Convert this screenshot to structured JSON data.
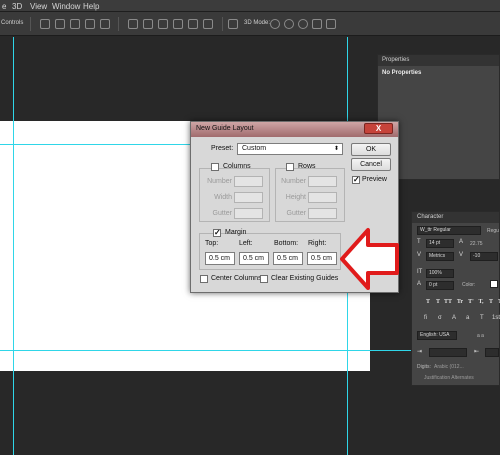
{
  "menu": [
    "e",
    "3D",
    "View",
    "Window",
    "Help"
  ],
  "options_bar": {
    "controls_label": "Controls",
    "mode_label": "3D Mode:"
  },
  "properties": {
    "title": "Properties",
    "content": "No Properties"
  },
  "character": {
    "title": "Character",
    "font_family": "W_ttr Regular",
    "font_style": "Regu",
    "size": "14 pt",
    "leading": "22.75",
    "kerning": "Metrics",
    "tracking": "-10",
    "vertical_scale": "100%",
    "baseline": "0 pt",
    "color_label": "Color:",
    "type_buttons": [
      "T",
      "T",
      "TT",
      "Tr",
      "T'",
      "T,",
      "T",
      "T"
    ],
    "language": "English: USA",
    "antialias": "a a",
    "digits_label": "Digits:",
    "digits_value": "Arabic (012...",
    "justification": "Justification Alternates"
  },
  "dialog": {
    "title": "New Guide Layout",
    "close_label": "X",
    "preset_label": "Preset:",
    "preset_value": "Custom",
    "ok_label": "OK",
    "cancel_label": "Cancel",
    "preview_label": "Preview",
    "preview_checked": true,
    "columns": {
      "label": "Columns",
      "checked": false,
      "fields": [
        "Number",
        "Width",
        "Gutter"
      ]
    },
    "rows": {
      "label": "Rows",
      "checked": false,
      "fields": [
        "Number",
        "Height",
        "Gutter"
      ]
    },
    "margin": {
      "label": "Margin",
      "checked": true,
      "top_label": "Top:",
      "left_label": "Left:",
      "bottom_label": "Bottom:",
      "right_label": "Right:",
      "top": "0.5 cm",
      "left": "0.5 cm",
      "bottom": "0.5 cm",
      "right": "0.5 cm"
    },
    "center_columns_label": "Center Columns",
    "clear_guides_label": "Clear Existing Guides"
  },
  "colors": {
    "guide": "#2fd6e8",
    "annotation_arrow": "#e01b1b",
    "workspace": "#282828"
  }
}
